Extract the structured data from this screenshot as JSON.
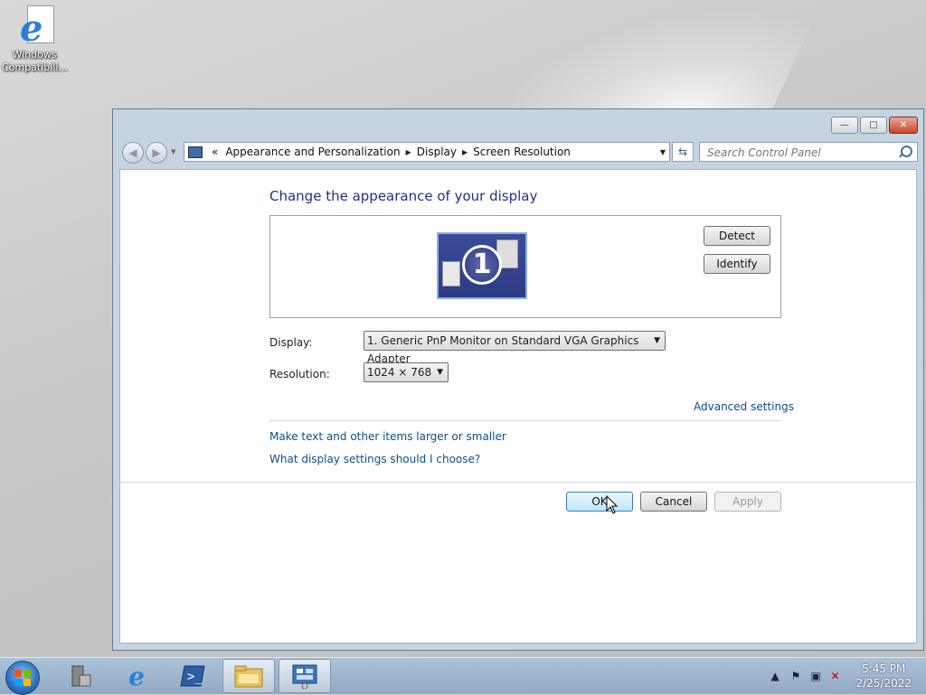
{
  "desktop": {
    "icon_label_line1": "Windows",
    "icon_label_line2": "Compatibili..."
  },
  "window": {
    "caption": {
      "minimize": "—",
      "maximize": "□",
      "close": "✕"
    },
    "nav": {
      "back": "◀",
      "forward": "▶",
      "address_prefix": "«",
      "breadcrumbs": [
        "Appearance and Personalization",
        "Display",
        "Screen Resolution"
      ],
      "refresh": "⇆",
      "search_placeholder": "Search Control Panel"
    },
    "content": {
      "title": "Change the appearance of your display",
      "monitor_number": "1",
      "detect_label": "Detect",
      "identify_label": "Identify",
      "display_label": "Display:",
      "display_value": "1. Generic PnP Monitor on Standard VGA Graphics Adapter",
      "resolution_label": "Resolution:",
      "resolution_value": "1024 × 768",
      "advanced_link": "Advanced settings",
      "link_text_size": "Make text and other items larger or smaller",
      "link_what_settings": "What display settings should I choose?",
      "ok_label": "OK",
      "cancel_label": "Cancel",
      "apply_label": "Apply"
    }
  },
  "taskbar": {
    "time": "5:45 PM",
    "date": "2/25/2022",
    "pinned": [
      "server-manager-icon",
      "internet-explorer-icon",
      "powershell-icon",
      "file-explorer-icon",
      "control-panel-icon"
    ]
  },
  "colors": {
    "link": "#0c4e8e",
    "title": "#1e3287",
    "window_frame": "#c6d3e0"
  }
}
